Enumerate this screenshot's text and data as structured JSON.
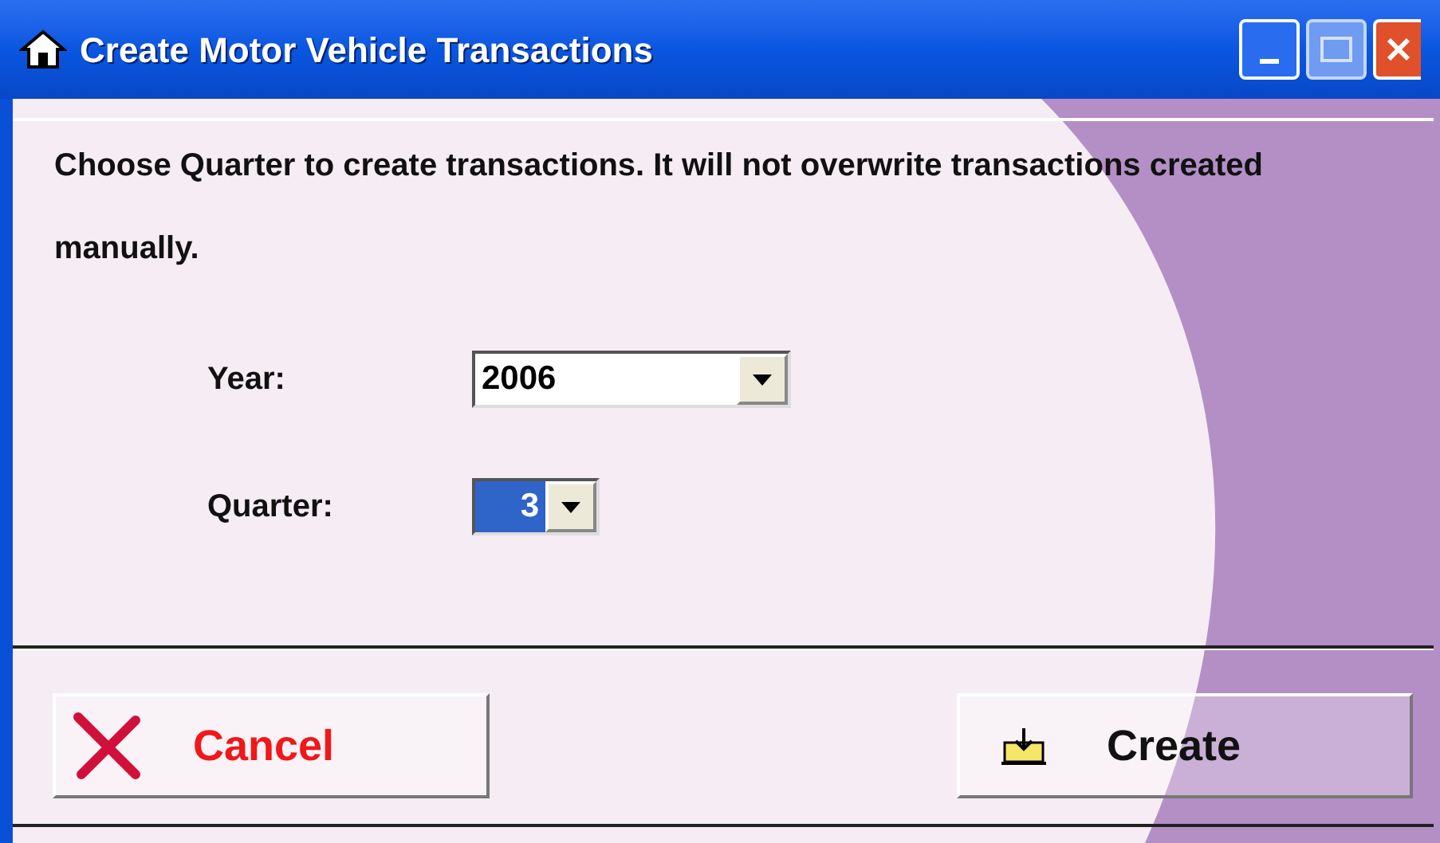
{
  "window": {
    "title": "Create Motor Vehicle Transactions"
  },
  "message": "Choose Quarter to create transactions. It will not overwrite transactions created manually.",
  "fields": [
    {
      "label": "Year:",
      "value": "2006",
      "focused": false,
      "kind": "wide"
    },
    {
      "label": "Quarter:",
      "value": "3",
      "focused": true,
      "kind": "narrow"
    }
  ],
  "buttons": [
    {
      "label": "Cancel",
      "kind": "cancel"
    },
    {
      "label": "Create",
      "kind": "create"
    }
  ]
}
